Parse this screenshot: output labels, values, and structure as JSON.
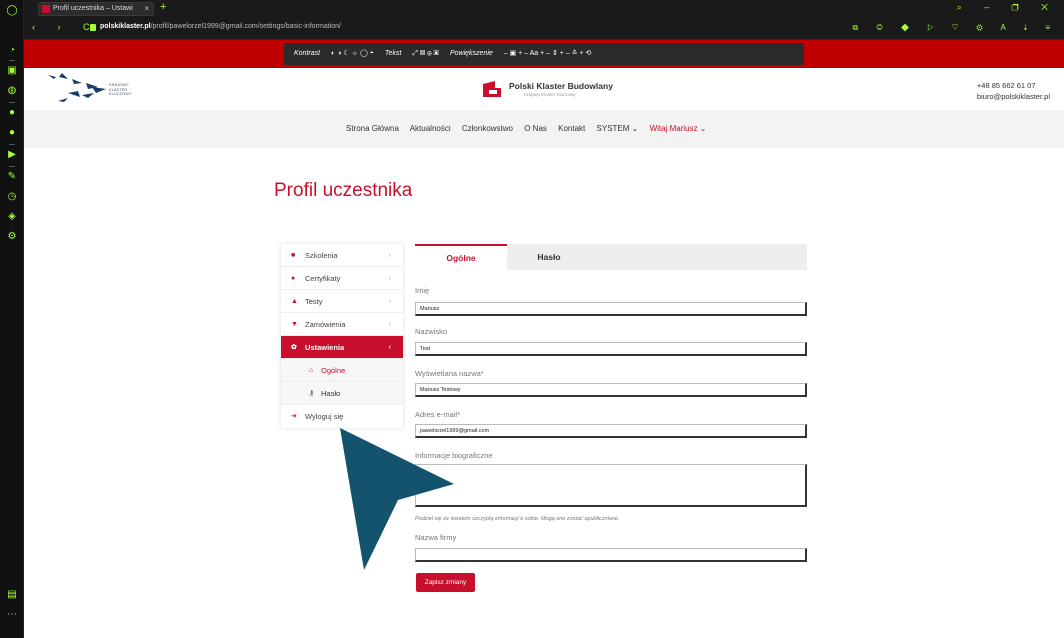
{
  "browser": {
    "tab_title": "Profil uczestnika – Ustawi",
    "tab_close": "×",
    "new_tab": "+",
    "url_domain": "polskiklaster.pl",
    "url_path": "/profil/pawelorzel1999@gmail.com/settings/basic-information/",
    "window_controls": "⌕ – ❐ ✕",
    "nav_buttons": "‹ › C",
    "addr_icons": "⧉ ◎ ◆ ▷ ♡ ⚙ A ⤓ ≡"
  },
  "a11y_toolbar": {
    "contrast_label": "Kontrast",
    "contrast_icons": "◐ ◑ ☾ ☼ ◯ ◓",
    "text_label": "Tekst",
    "text_icons": "⤢ ▤ ⊕ ▣",
    "zoom_label": "Powiększenie",
    "zoom_controls": "– ▣ +   – Aa +   – ⇕ +   – ≛ +   ⟲"
  },
  "header": {
    "kkk_line1": "KRAJOWY",
    "kkk_line2": "KLASTER",
    "kkk_line3": "KLUCZOWY",
    "brand_title": "Polski Klaster Budowlany",
    "brand_sub": "Krajowy Klaster Kluczowy",
    "phone": "+48 85 662 61 07",
    "email": "biuro@polskiklaster.pl"
  },
  "nav": {
    "home": "Strona Główna",
    "news": "Aktualności",
    "membership": "Członkowstwo",
    "about": "O Nas",
    "contact": "Kontakt",
    "system": "SYSTEM ⌄",
    "user": "Witaj Mariusz ⌄"
  },
  "page": {
    "title": "Profil uczestnika"
  },
  "menu": {
    "trainings": "Szkolenia",
    "certificates": "Certyfikaty",
    "tests": "Testy",
    "orders": "Zamówienia",
    "settings": "Ustawienia",
    "general": "Ogólne",
    "password": "Hasło",
    "logout": "Wyloguj się"
  },
  "tabs": {
    "general": "Ogólne",
    "password": "Hasło"
  },
  "form": {
    "first_name_label": "Imię",
    "first_name_value": "Mariusz",
    "last_name_label": "Nazwisko",
    "last_name_value": "Test",
    "display_label": "Wyświetlana nazwa*",
    "display_value": "Mariusz Testowy",
    "email_label": "Adres e-mail*",
    "email_value": "pawelorzel1999@gmail.com",
    "bio_label": "Informacje biograficzne",
    "bio_hint": "Podziel się ze światem szczyptą informacji o sobie. Mogą one zostać upublicznione.",
    "company_label": "Nazwa firmy",
    "company_value": "",
    "save": "Zapisz zmiany"
  },
  "colors": {
    "brand_red": "#c8102e",
    "toolbar_red": "#c00000",
    "arrow": "#14536e",
    "opera_accent": "#a6ff3a"
  }
}
